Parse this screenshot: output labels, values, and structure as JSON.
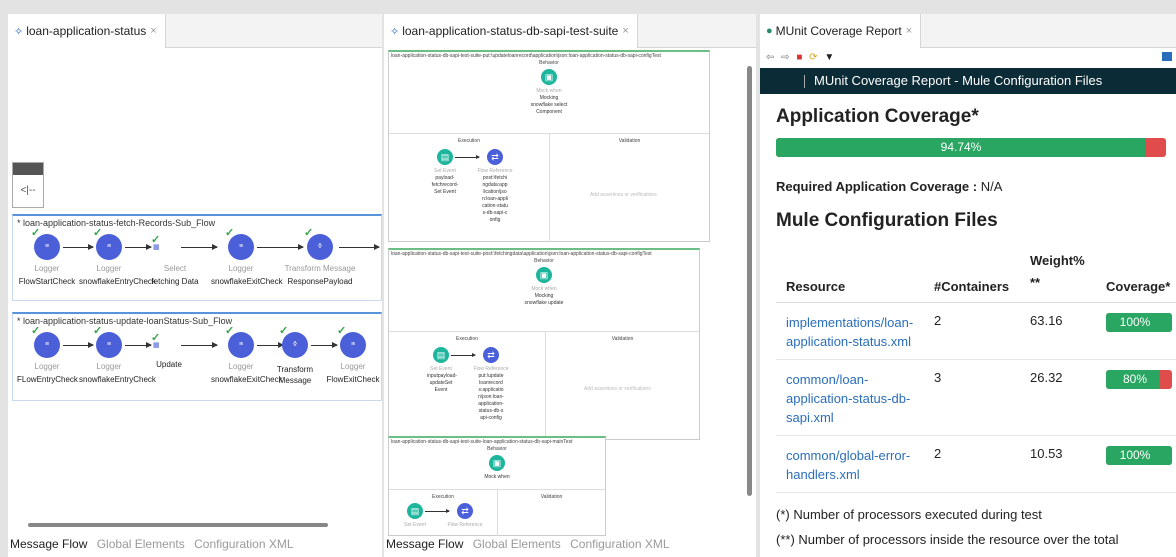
{
  "pane1": {
    "tab_title": "loan-application-status",
    "collapse_label": "<|--",
    "flows": [
      {
        "title": "loan-application-status-fetch-Records-Sub_Flow",
        "nodes": [
          {
            "kind": "logger",
            "type": "Logger",
            "name": "FlowStartCheck",
            "checked": true
          },
          {
            "kind": "logger",
            "type": "Logger",
            "name": "snowflakeEntryCheck",
            "checked": true
          },
          {
            "kind": "select",
            "type": "Select",
            "name": "fetching Data",
            "checked": true
          },
          {
            "kind": "logger",
            "type": "Logger",
            "name": "snowflakeExitCheck",
            "checked": true
          },
          {
            "kind": "transform",
            "type": "Transform Message",
            "name": "ResponsePayload",
            "checked": true
          }
        ]
      },
      {
        "title": "loan-application-status-update-loanStatus-Sub_Flow",
        "nodes": [
          {
            "kind": "logger",
            "type": "Logger",
            "name": "FLowEntryCheck",
            "checked": true
          },
          {
            "kind": "logger",
            "type": "Logger",
            "name": "snowflakeEntryCheck",
            "checked": true
          },
          {
            "kind": "update",
            "type": "",
            "name": "Update",
            "checked": true
          },
          {
            "kind": "logger",
            "type": "Logger",
            "name": "snowflakeExitCheck",
            "checked": true
          },
          {
            "kind": "transform",
            "type": "",
            "name": "Transform Message",
            "checked": true
          },
          {
            "kind": "logger",
            "type": "Logger",
            "name": "FlowExitCheck",
            "checked": true
          }
        ]
      }
    ],
    "bottom_tabs": [
      "Message Flow",
      "Global Elements",
      "Configuration XML"
    ]
  },
  "pane2": {
    "tab_title": "loan-application-status-db-sapi-test-suite",
    "suites": [
      {
        "title": "loan-application-status-db-sapi-test-suite-put:\\updateloanrecord\\application\\json:loan-application-status-db-sapi-configTest",
        "behavior_label": "Behavior",
        "behavior_type": "Mock when",
        "behavior_name": "Mocking snowflake select Component",
        "execution_label": "Execution",
        "validation_label": "Validation",
        "exec1_type": "Set Event",
        "exec1_name": "payload-fetchrecord-Set Event",
        "exec2_type": "Flow Reference",
        "exec2_name": "post:\\fetchingdata:application\\json:loan-application-status-db-sapi-config",
        "drop_hint": "Add assertions or verifications"
      },
      {
        "title": "loan-application-status-db-sapi-test-suite-post:\\fetchingdata\\application\\json:loan-application-status-db-sapi-configTest",
        "behavior_label": "Behavior",
        "behavior_type": "Mock when",
        "behavior_name": "Mocking snowflake update",
        "execution_label": "Execution",
        "validation_label": "Validation",
        "exec1_type": "Set Event",
        "exec1_name": "inputpayload-updateSet Event",
        "exec2_type": "Flow Reference",
        "exec2_name": "put:\\updateloanrecords:application\\json:loan-application-status-db-sapi-config",
        "drop_hint": "Add assertions or verifications"
      },
      {
        "title": "loan-application-status-db-sapi-test-suite-loan-application-status-db-sapi-mainTest",
        "behavior_label": "Behavior",
        "behavior_type": "",
        "behavior_name": "Mock when",
        "execution_label": "Execution",
        "validation_label": "Validation",
        "exec1_type": "Set Event",
        "exec1_name": "",
        "exec2_type": "Flow Reference",
        "exec2_name": "",
        "drop_hint": ""
      }
    ],
    "bottom_tabs": [
      "Message Flow",
      "Global Elements",
      "Configuration XML"
    ]
  },
  "pane3": {
    "tab_title": "MUnit Coverage Report",
    "header_title": "MUnit Coverage Report - Mule Configuration Files",
    "app_coverage_heading": "Application Coverage*",
    "app_coverage_value": "94.74%",
    "app_coverage_fraction": 0.9474,
    "required_label": "Required Application Coverage :",
    "required_value": "N/A",
    "config_heading": "Mule Configuration Files",
    "columns": [
      "Resource",
      "#Containers",
      "Weight% **",
      "Coverage*"
    ],
    "rows": [
      {
        "resource": "implementations/loan-application-status.xml",
        "containers": "2",
        "weight": "63.16",
        "coverage": "100%",
        "fraction": 1.0
      },
      {
        "resource": "common/loan-application-status-db-sapi.xml",
        "containers": "3",
        "weight": "26.32",
        "coverage": "80%",
        "fraction": 0.8
      },
      {
        "resource": "common/global-error-handlers.xml",
        "containers": "2",
        "weight": "10.53",
        "coverage": "100%",
        "fraction": 1.0
      }
    ],
    "note1": "(*) Number of processors executed during test",
    "note2": "(**) Number of processors inside the resource over the total"
  },
  "colors": {
    "accent_green": "#29a661",
    "accent_red": "#e04b4b",
    "header_dark": "#0b2b36",
    "link_blue": "#2a6ebb",
    "node_blue": "#4b5fd9",
    "test_teal": "#1db59c"
  }
}
